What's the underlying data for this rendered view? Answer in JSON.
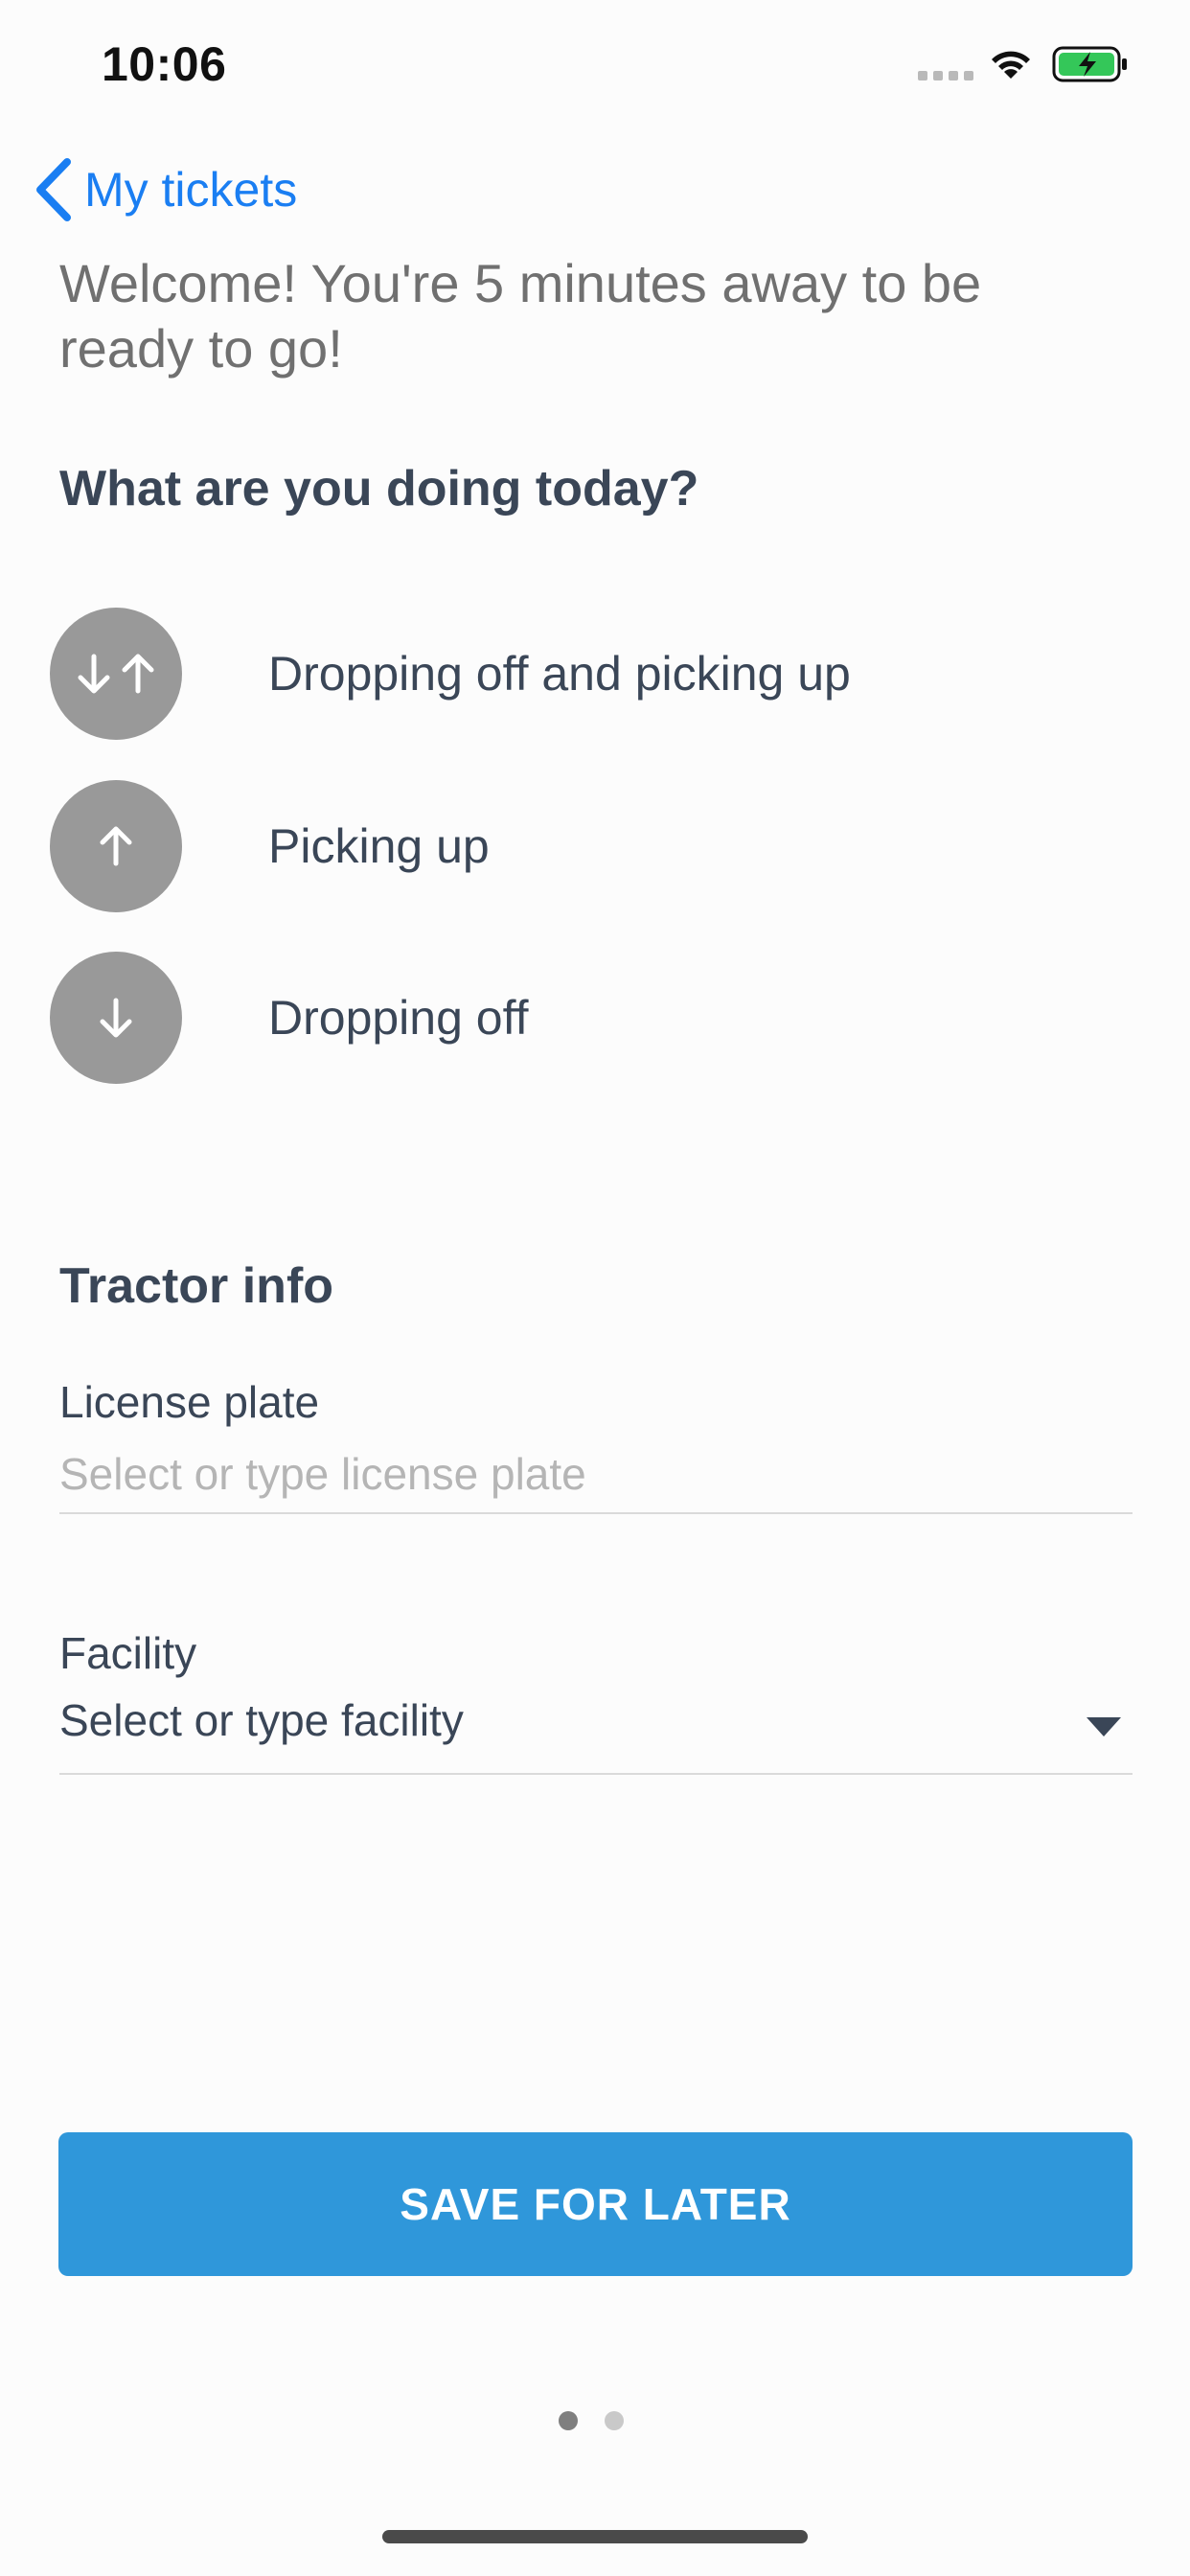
{
  "status_bar": {
    "time": "10:06",
    "icons": [
      "cellular-signal-icon",
      "wifi-icon",
      "battery-charging-icon"
    ],
    "battery_color": "#34c759"
  },
  "nav": {
    "back_label": "My tickets",
    "accent_color": "#1a7ef2"
  },
  "welcome_text": "Welcome! You're 5 minutes away to be ready to go!",
  "activity": {
    "title": "What are you doing today?",
    "options": [
      {
        "label": "Dropping off and picking up",
        "icon": "arrows-down-up-icon"
      },
      {
        "label": "Picking up",
        "icon": "arrow-up-icon"
      },
      {
        "label": "Dropping off",
        "icon": "arrow-down-icon"
      }
    ]
  },
  "tractor": {
    "title": "Tractor info",
    "license_label": "License plate",
    "license_placeholder": "Select or type license plate",
    "license_value": "",
    "facility_label": "Facility",
    "facility_value": "Select or type facility"
  },
  "actions": {
    "save_label": "SAVE FOR LATER",
    "save_color": "#2f97da"
  },
  "pager": {
    "total": 2,
    "active_index": 0
  }
}
